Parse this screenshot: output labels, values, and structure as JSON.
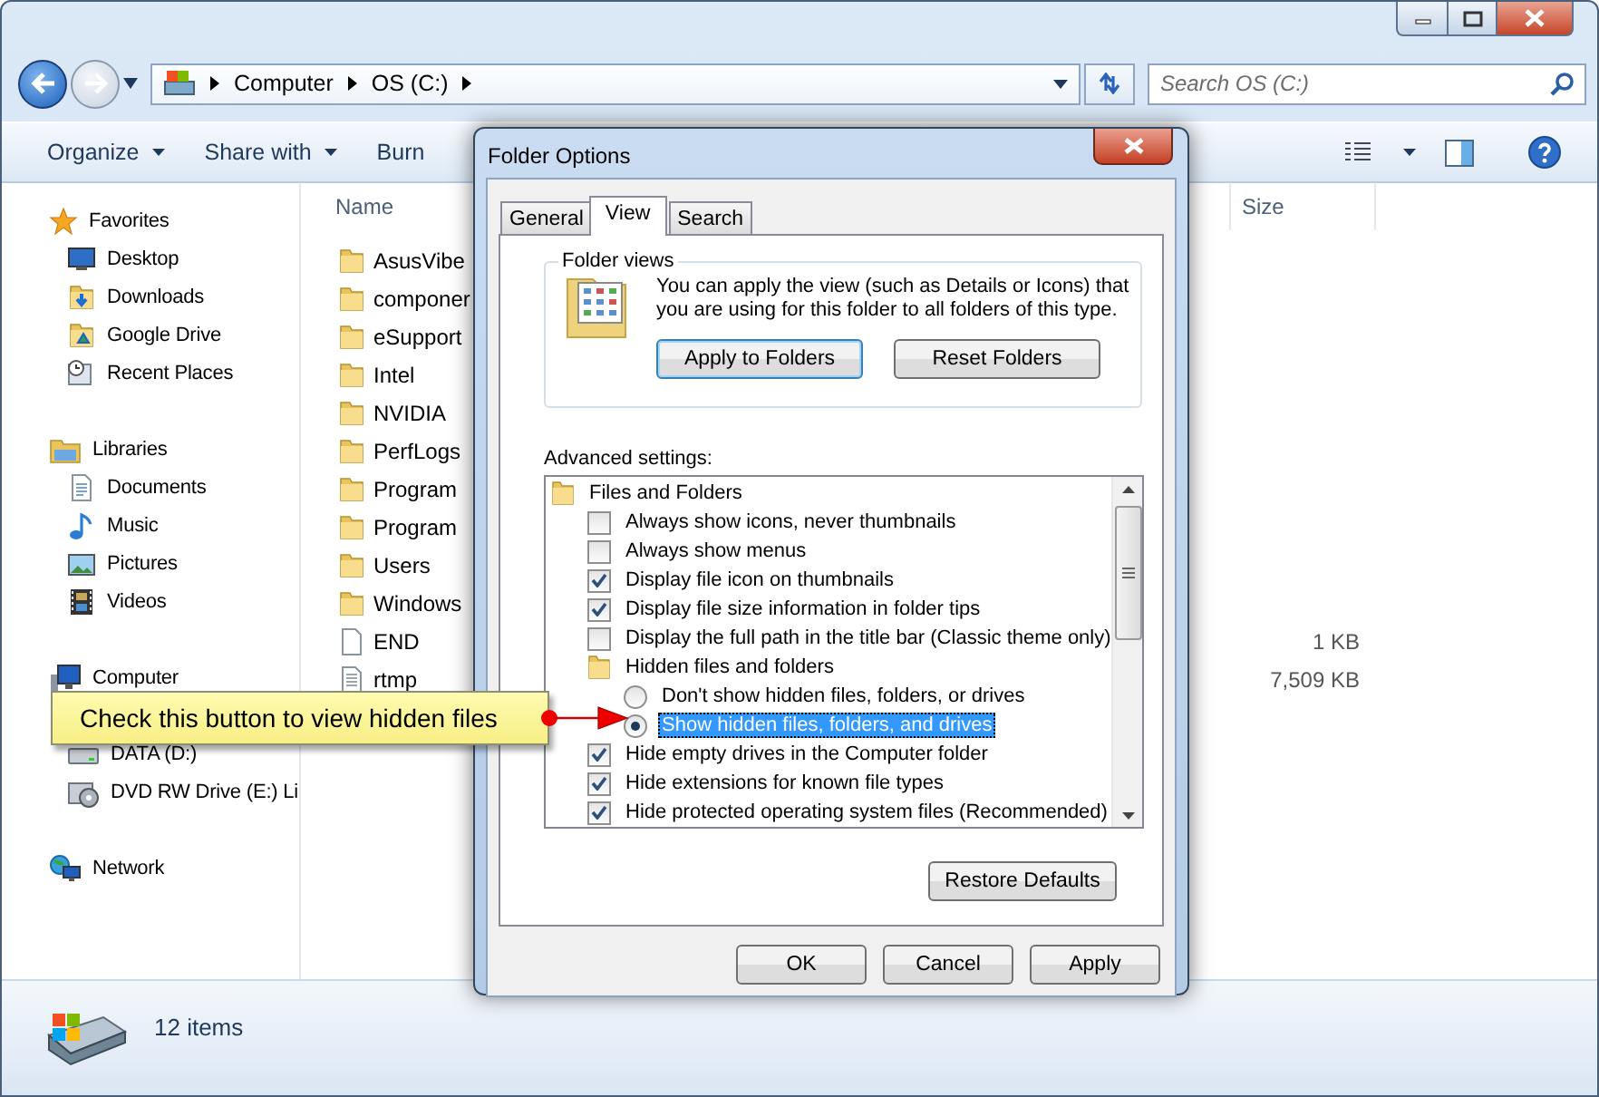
{
  "address_bar": {
    "breadcrumbs": [
      "Computer",
      "OS (C:)"
    ]
  },
  "search": {
    "placeholder": "Search OS (C:)"
  },
  "toolbar": {
    "items": [
      {
        "label": "Organize",
        "dropdown": true
      },
      {
        "label": "Share with",
        "dropdown": true
      },
      {
        "label": "Burn",
        "dropdown": false
      }
    ]
  },
  "sidebar": {
    "groups": [
      {
        "label": "Favorites",
        "items": [
          "Desktop",
          "Downloads",
          "Google Drive",
          "Recent Places"
        ]
      },
      {
        "label": "Libraries",
        "items": [
          "Documents",
          "Music",
          "Pictures",
          "Videos"
        ]
      },
      {
        "label": "Computer",
        "items": [
          "DATA (D:)",
          "DVD RW Drive (E:) Li"
        ]
      },
      {
        "label": "Network"
      }
    ]
  },
  "table": {
    "columns": [
      "Name",
      "Size"
    ],
    "rows": [
      {
        "name": "AsusVibe",
        "kind": "folder"
      },
      {
        "name": "componer",
        "kind": "folder"
      },
      {
        "name": "eSupport",
        "kind": "folder"
      },
      {
        "name": "Intel",
        "kind": "folder"
      },
      {
        "name": "NVIDIA",
        "kind": "folder"
      },
      {
        "name": "PerfLogs",
        "kind": "folder"
      },
      {
        "name": "Program",
        "kind": "folder"
      },
      {
        "name": "Program",
        "kind": "folder"
      },
      {
        "name": "Users",
        "kind": "folder"
      },
      {
        "name": "Windows",
        "kind": "folder"
      },
      {
        "name": "END",
        "kind": "file",
        "size": "1 KB"
      },
      {
        "name": "rtmp",
        "kind": "text",
        "size": "7,509 KB"
      }
    ]
  },
  "status_bar": {
    "count": "12 items"
  },
  "dialog": {
    "title": "Folder Options",
    "tabs": [
      {
        "label": "General",
        "selected": false
      },
      {
        "label": "View",
        "selected": true
      },
      {
        "label": "Search",
        "selected": false
      }
    ],
    "folder_views": {
      "legend": "Folder views",
      "description": "You can apply the view (such as Details or Icons) that you are using for this folder to all folders of this type.",
      "buttons": [
        {
          "label": "Apply to Folders",
          "default": true
        },
        {
          "label": "Reset Folders",
          "default": false
        }
      ]
    },
    "advanced": {
      "label": "Advanced settings:",
      "items": [
        {
          "kind": "folder",
          "label": "Files and Folders",
          "children": [
            {
              "kind": "checkbox",
              "label": "Always show icons, never thumbnails",
              "checked": false
            },
            {
              "kind": "checkbox",
              "label": "Always show menus",
              "checked": false
            },
            {
              "kind": "checkbox",
              "label": "Display file icon on thumbnails",
              "checked": true
            },
            {
              "kind": "checkbox",
              "label": "Display file size information in folder tips",
              "checked": true
            },
            {
              "kind": "checkbox",
              "label": "Display the full path in the title bar (Classic theme only)",
              "checked": false
            },
            {
              "kind": "folder",
              "label": "Hidden files and folders",
              "children": [
                {
                  "kind": "radio",
                  "label": "Don't show hidden files, folders, or drives",
                  "selected": false
                },
                {
                  "kind": "radio",
                  "label": "Show hidden files, folders, and drives",
                  "selected": true
                }
              ]
            },
            {
              "kind": "checkbox",
              "label": "Hide empty drives in the Computer folder",
              "checked": true
            },
            {
              "kind": "checkbox",
              "label": "Hide extensions for known file types",
              "checked": true
            },
            {
              "kind": "checkbox",
              "label": "Hide protected operating system files (Recommended)",
              "checked": true
            }
          ]
        }
      ]
    },
    "restore_button": "Restore Defaults",
    "buttons": [
      "OK",
      "Cancel",
      "Apply"
    ]
  },
  "callout": {
    "text": "Check this button to view hidden files"
  }
}
